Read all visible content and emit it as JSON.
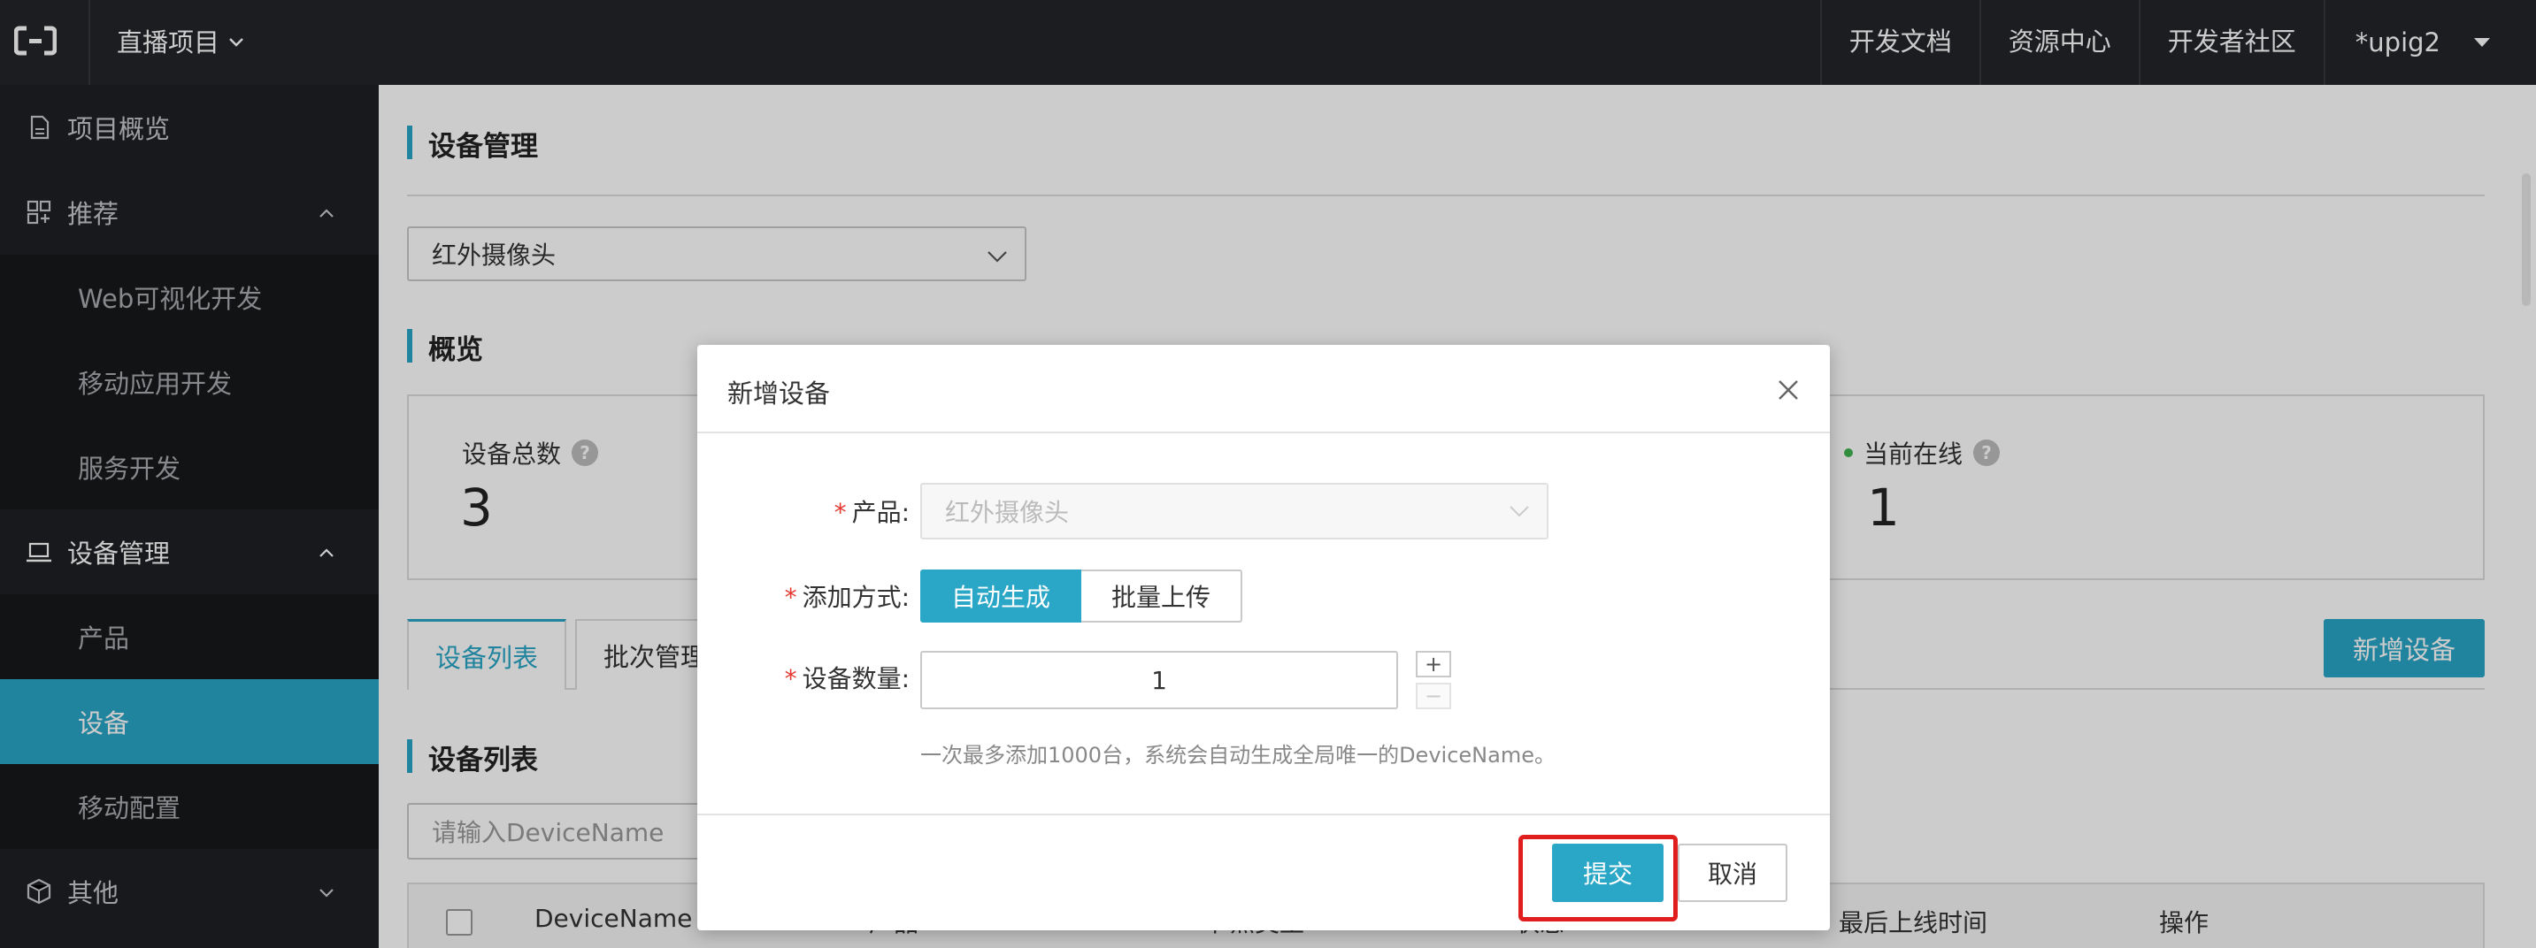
{
  "topbar": {
    "project": "直播项目",
    "nav": [
      "开发文档",
      "资源中心",
      "开发者社区"
    ],
    "user": "*upig2"
  },
  "sidebar": {
    "overview": "项目概览",
    "recommend": "推荐",
    "recommend_items": [
      "Web可视化开发",
      "移动应用开发",
      "服务开发"
    ],
    "device_mgmt": "设备管理",
    "device_items": [
      "产品",
      "设备",
      "移动配置"
    ],
    "other": "其他"
  },
  "main": {
    "title": "设备管理",
    "product_select": "红外摄像头",
    "overview_title": "概览",
    "total_label": "设备总数",
    "total_value": "3",
    "online_label": "当前在线",
    "online_value": "1",
    "tabs": [
      "设备列表",
      "批次管理"
    ],
    "add_button": "新增设备",
    "list_title": "设备列表",
    "search_placeholder": "请输入DeviceName",
    "columns": [
      "DeviceName",
      "产品",
      "节点类型",
      "状态",
      "最后上线时间",
      "操作"
    ]
  },
  "modal": {
    "title": "新增设备",
    "product_label": "产品:",
    "product_value": "红外摄像头",
    "method_label": "添加方式:",
    "method_auto": "自动生成",
    "method_batch": "批量上传",
    "count_label": "设备数量:",
    "count_value": "1",
    "plus": "+",
    "minus": "−",
    "hint": "一次最多添加1000台，系统会自动生成全局唯一的DeviceName。",
    "submit": "提交",
    "cancel": "取消"
  },
  "colors": {
    "accent": "#2aa6c6",
    "topbar_bg": "#22252a",
    "sidebar_bg": "#1e2023",
    "highlight": "#e01e1e"
  }
}
